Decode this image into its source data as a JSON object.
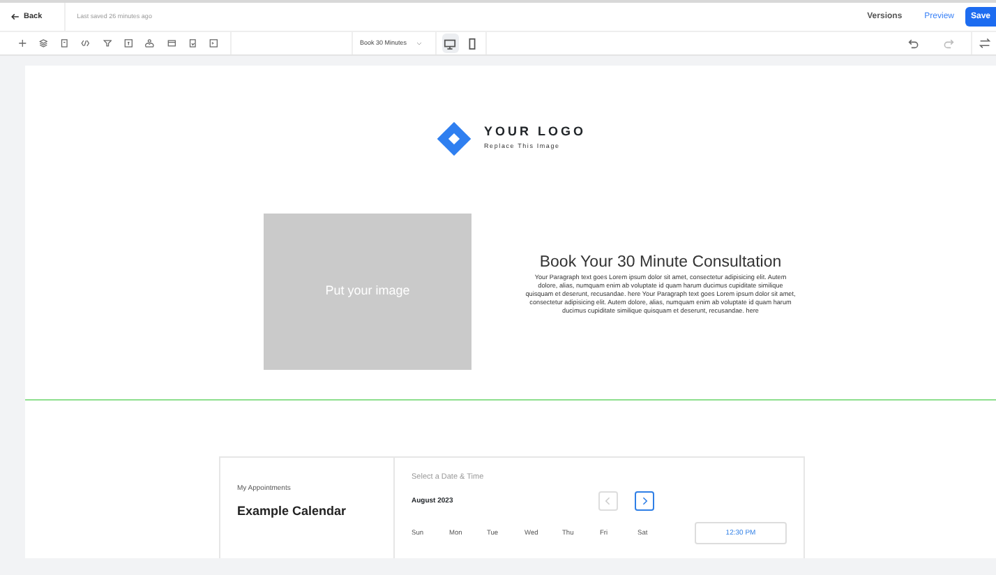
{
  "topbar": {
    "back": "Back",
    "saved": "Last saved 26 minutes ago",
    "versions": "Versions",
    "preview": "Preview",
    "save": "Save"
  },
  "toolbar": {
    "page_select": "Book 30 Minutes",
    "devices": [
      {
        "kind": "desktop",
        "selected": true
      },
      {
        "kind": "mobile",
        "selected": false
      }
    ]
  },
  "logo": {
    "title": "YOUR LOGO",
    "subtitle": "Replace This Image"
  },
  "hero": {
    "image_label": "Put your image",
    "heading": "Book Your 30 Minute Consultation",
    "paragraph": "Your Paragraph text goes Lorem ipsum dolor sit amet, consectetur adipisicing elit. Autem dolore, alias, numquam enim ab voluptate id quam harum ducimus cupiditate similique quisquam et deserunt, recusandae. here Your Paragraph text goes Lorem ipsum dolor sit amet, consectetur adipisicing elit. Autem dolore, alias, numquam enim ab voluptate id quam harum ducimus cupiditate similique quisquam et deserunt, recusandae. here"
  },
  "calendar": {
    "owner": "My Appointments",
    "name": "Example Calendar",
    "prompt": "Select a Date & Time",
    "month": "August 2023",
    "nav": [
      {
        "kind": "prev",
        "disabled": true
      },
      {
        "kind": "next",
        "disabled": false
      }
    ],
    "weekdays": [
      "Sun",
      "Mon",
      "Tue",
      "Wed",
      "Thu",
      "Fri",
      "Sat"
    ],
    "time_slot": "12:30 PM"
  }
}
